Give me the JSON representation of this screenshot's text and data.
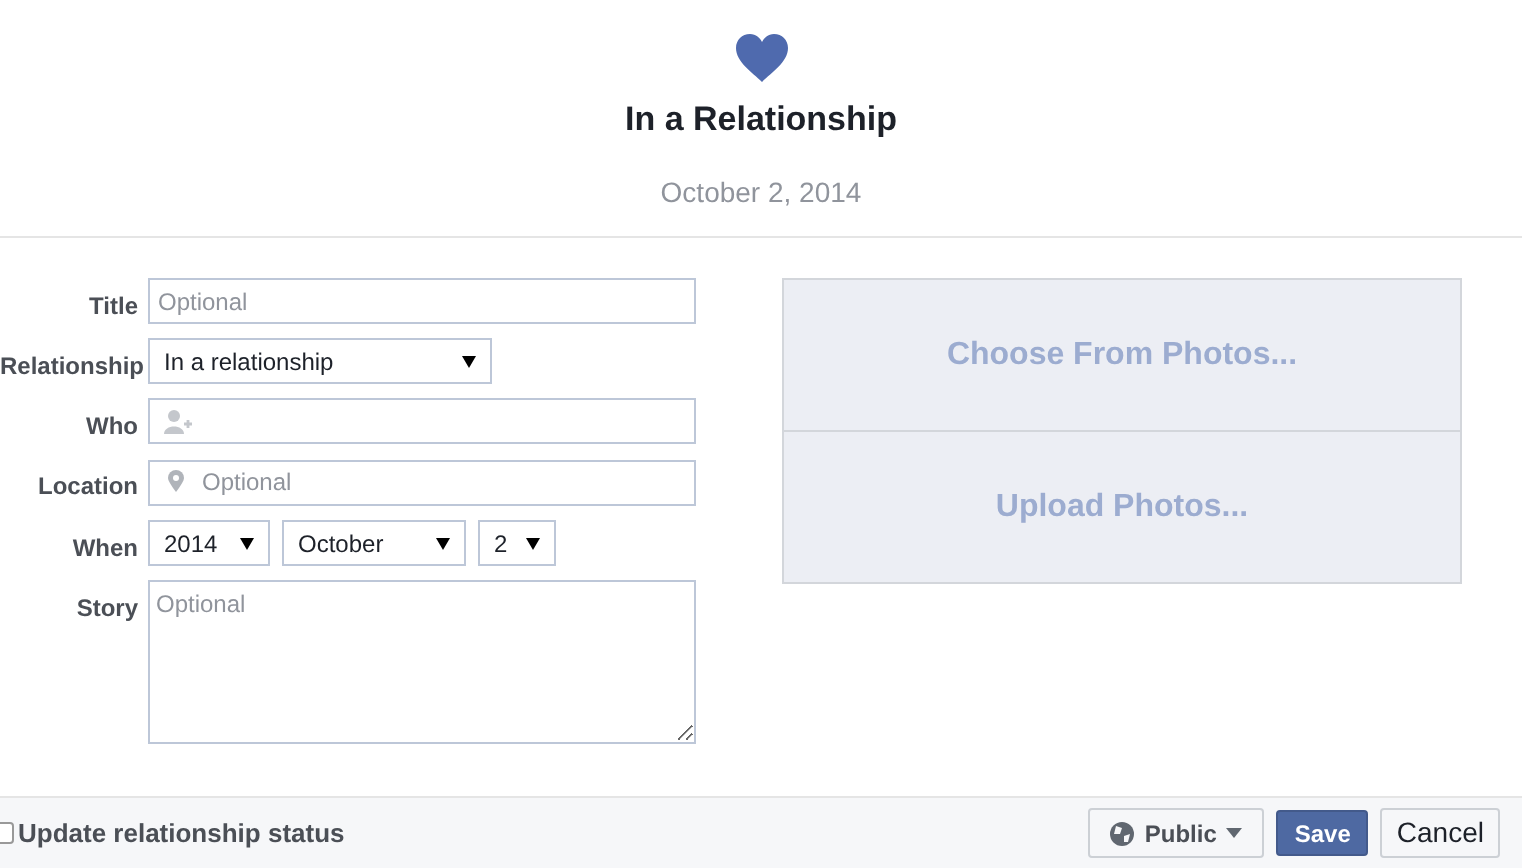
{
  "header": {
    "title": "In a Relationship",
    "date": "October 2, 2014"
  },
  "form": {
    "title": {
      "label": "Title",
      "placeholder": "Optional"
    },
    "relationship": {
      "label": "Relationship",
      "value": "In a relationship"
    },
    "who": {
      "label": "Who"
    },
    "location": {
      "label": "Location",
      "placeholder": "Optional"
    },
    "when": {
      "label": "When",
      "year": "2014",
      "month": "October",
      "day": "2"
    },
    "story": {
      "label": "Story",
      "placeholder": "Optional"
    }
  },
  "photos": [
    "Choose From Photos...",
    "Upload Photos..."
  ],
  "footer": {
    "update_status": {
      "label": "Update relationship status",
      "checked": false
    },
    "privacy": "Public",
    "save": "Save",
    "cancel": "Cancel"
  }
}
